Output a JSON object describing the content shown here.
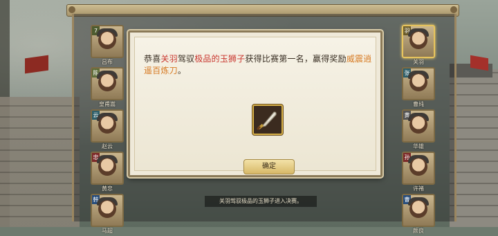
{
  "dialog": {
    "msg": {
      "t1": "恭喜",
      "hero": "关羽",
      "t2": "驾驭",
      "steed": "极品的玉狮子",
      "t3": "获得比赛第一名，赢得奖励",
      "reward": "威震逍遥百炼刀",
      "t4": "。"
    },
    "confirm_label": "确定",
    "reward_icon": "blade-icon"
  },
  "log_text": "关羽驾驭极品的玉狮子进入决赛。",
  "left_heroes": [
    {
      "badge": "7",
      "name": "吕布",
      "color": "#4d5b2f"
    },
    {
      "badge": "陈",
      "name": "皇甫嵩",
      "color": "#5f6e3a"
    },
    {
      "badge": "云",
      "name": "赵云",
      "color": "#2f5f6a"
    },
    {
      "badge": "忠",
      "name": "黄忠",
      "color": "#7d2a2a"
    },
    {
      "badge": "韩",
      "name": "马超",
      "color": "#2a4f7d"
    }
  ],
  "right_heroes": [
    {
      "badge": "羽",
      "name": "关羽",
      "color": "#6a5b2a",
      "selected": true
    },
    {
      "badge": "张",
      "name": "曹纯",
      "color": "#2f5f6a"
    },
    {
      "badge": "黄",
      "name": "华雄",
      "color": "#555555"
    },
    {
      "badge": "孙",
      "name": "许褚",
      "color": "#7d2a2a"
    },
    {
      "badge": "曹",
      "name": "颜良",
      "color": "#2a4f7d"
    }
  ]
}
